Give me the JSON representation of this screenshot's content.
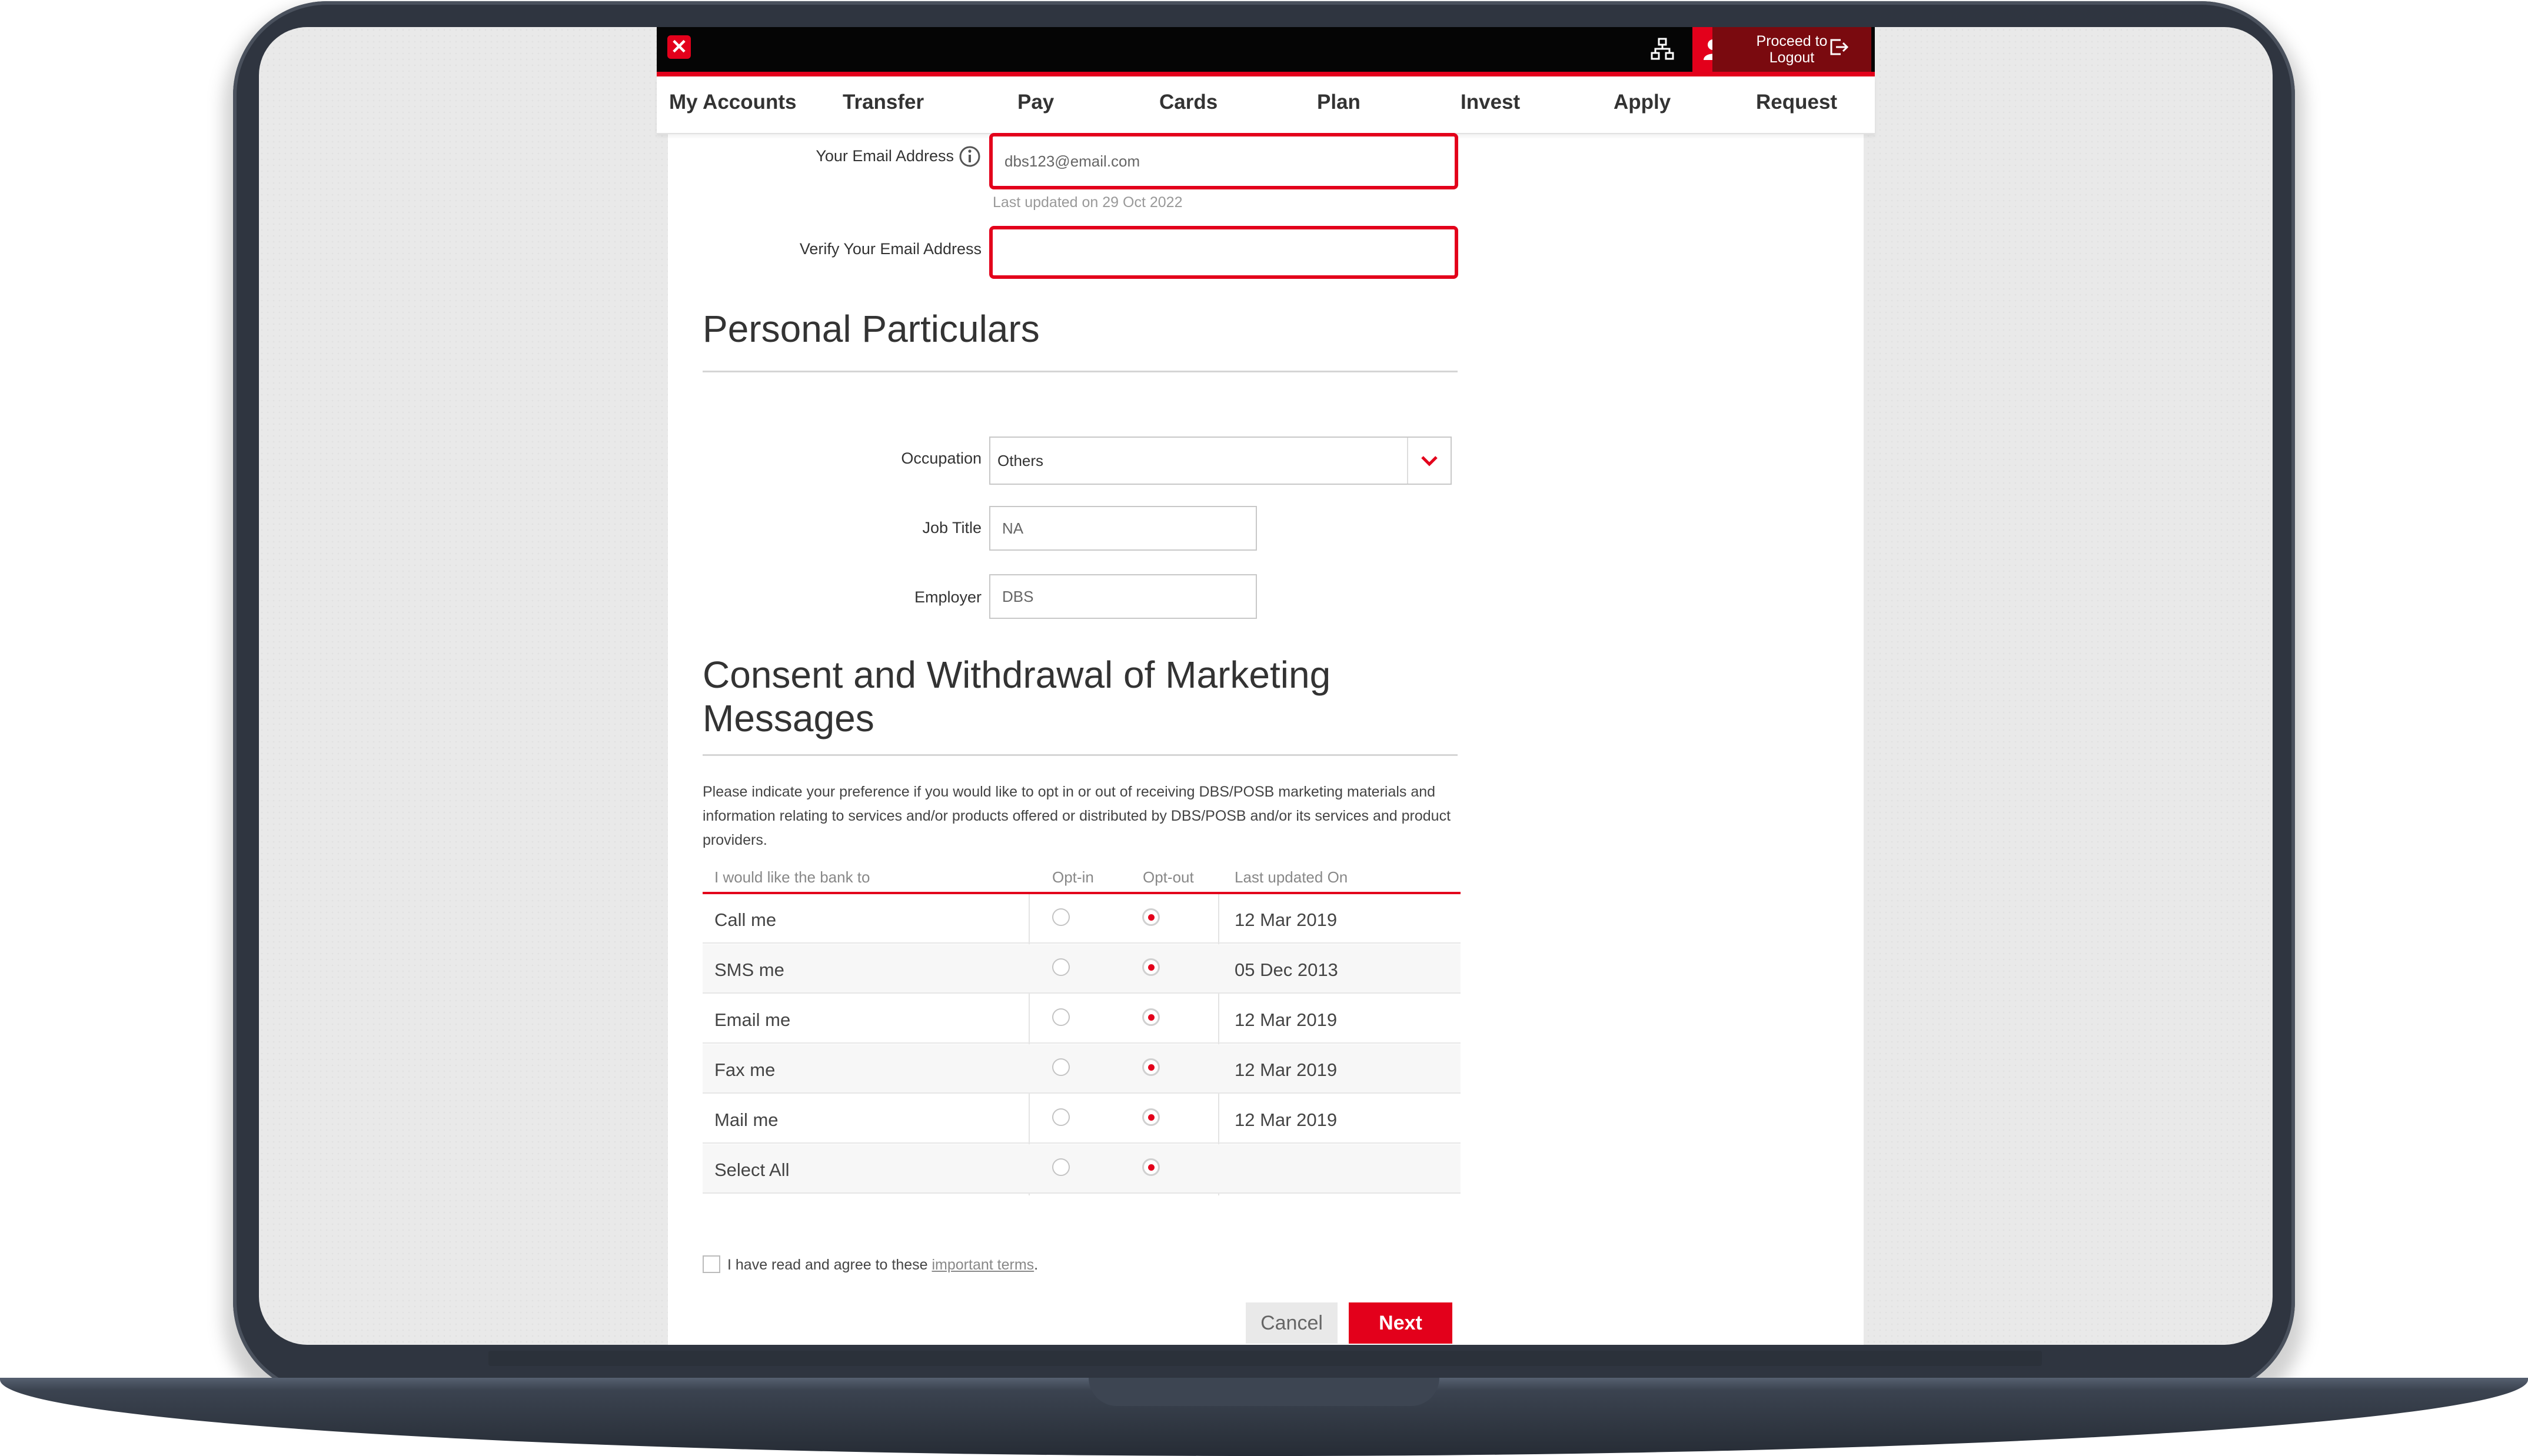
{
  "nav": {
    "items": [
      "My Accounts",
      "Transfer",
      "Pay",
      "Cards",
      "Plan",
      "Invest",
      "Apply",
      "Request"
    ],
    "logout_line1": "Proceed to",
    "logout_line2": "Logout"
  },
  "email": {
    "label": "Your Email Address",
    "value": "dbs123@email.com",
    "updated_note": "Last updated on 29 Oct 2022",
    "verify_label": "Verify Your Email Address",
    "verify_value": ""
  },
  "personal": {
    "heading": "Personal Particulars",
    "occupation_label": "Occupation",
    "occupation_value": "Others",
    "job_title_label": "Job Title",
    "job_title_value": "NA",
    "employer_label": "Employer",
    "employer_value": "DBS"
  },
  "consent": {
    "heading_line1": "Consent and Withdrawal of Marketing",
    "heading_line2": "Messages",
    "description": "Please indicate your preference if you would like to opt in or out of receiving DBS/POSB marketing materials and information relating to services and/or products offered or distributed by DBS/POSB and/or its services and product providers.",
    "columns": [
      "I would like the bank to",
      "Opt-in",
      "Opt-out",
      "Last updated On"
    ],
    "rows": [
      {
        "label": "Call me",
        "date": "12 Mar 2019",
        "selection": "opt-out"
      },
      {
        "label": "SMS me",
        "date": "05 Dec 2013",
        "selection": "opt-out"
      },
      {
        "label": "Email me",
        "date": "12 Mar 2019",
        "selection": "opt-out"
      },
      {
        "label": "Fax me",
        "date": "12 Mar 2019",
        "selection": "opt-out"
      },
      {
        "label": "Mail me",
        "date": "12 Mar 2019",
        "selection": "opt-out"
      },
      {
        "label": "Select All",
        "date": "",
        "selection": "opt-out"
      }
    ],
    "terms_prefix": "I have read and agree to these",
    "terms_link": "important terms",
    "terms_suffix": ".",
    "terms_checked": false
  },
  "actions": {
    "cancel": "Cancel",
    "next": "Next"
  },
  "colors": {
    "brand_red": "#e3001b",
    "logout_bg": "#7a0a0f",
    "frame": "#2f3540"
  }
}
